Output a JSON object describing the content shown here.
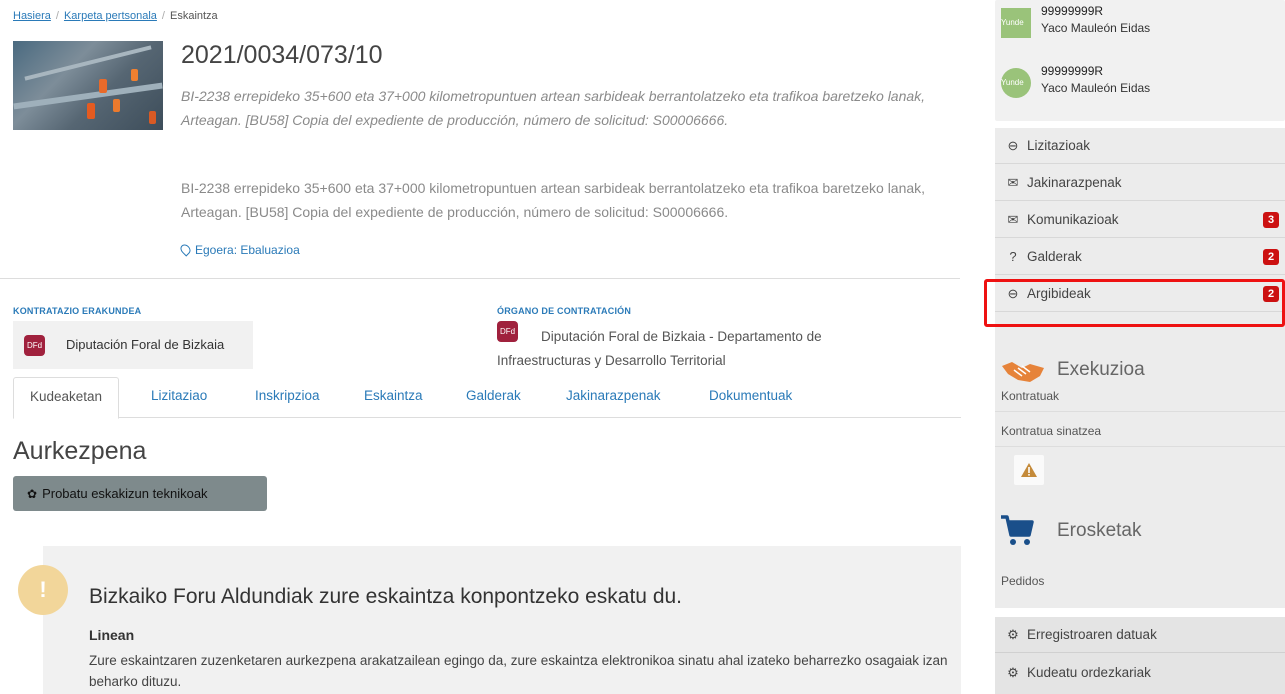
{
  "breadcrumb": {
    "home": "Hasiera",
    "folder": "Karpeta pertsonala",
    "current": "Eskaintza"
  },
  "header": {
    "expedient": "2021/0034/073/10",
    "description_italic": "BI-2238 errepideko 35+600 eta 37+000 kilometropuntuen artean sarbideak berrantolatzeko eta trafikoa baretzeko lanak, Arteagan. [BU58] Copia del expediente de producción, número de solicitud: S00006666.",
    "description": "BI-2238 errepideko 35+600 eta 37+000 kilometropuntuen artean sarbideak berrantolatzeko eta trafikoa baretzeko lanak, Arteagan. [BU58] Copia del expediente de producción, número de solicitud: S00006666.",
    "status": "Egoera: Ebaluazioa"
  },
  "org": {
    "contracting_label": "KONTRATAZIO ERAKUNDEA",
    "contracting_logo": "DFd",
    "contracting_name": "Diputación Foral de Bizkaia",
    "organ_label": "ÓRGANO DE CONTRATACIÓN",
    "organ_logo": "DFd",
    "organ_name": "Diputación Foral de Bizkaia - Departamento de Infraestructuras y Desarrollo Territorial"
  },
  "tabs": [
    {
      "label": "Kudeaketan"
    },
    {
      "label": "Lizitaziao"
    },
    {
      "label": "Inskripzioa"
    },
    {
      "label": "Eskaintza"
    },
    {
      "label": "Galderak"
    },
    {
      "label": "Jakinarazpenak"
    },
    {
      "label": "Dokumentuak"
    }
  ],
  "main": {
    "section_title": "Aurkezpena",
    "tech_button": "Probatu eskakizun teknikoak",
    "alert_icon": "!",
    "alert_title": "Bizkaiko Foru Aldundiak zure eskaintza konpontzeko eskatu du.",
    "alert_subtitle": "Linean",
    "alert_body": "Zure eskaintzaren zuzenketaren aurkezpena arakatzailean egingo da, zure eskaintza elektronikoa sinatu ahal izateko beharrezko osagaiak izan beharko dituzu."
  },
  "users": [
    {
      "id": "99999999R",
      "name": "Yaco Mauleón Eidas",
      "avatar": "Yunde"
    },
    {
      "id": "99999999R",
      "name": "Yaco Mauleón Eidas",
      "avatar": "Yunde"
    }
  ],
  "menu": [
    {
      "label": "Lizitazioak",
      "icon": "inbox-icon",
      "badge": ""
    },
    {
      "label": "Jakinarazpenak",
      "icon": "envelope-icon",
      "badge": ""
    },
    {
      "label": "Komunikazioak",
      "icon": "envelope-icon",
      "badge": "3"
    },
    {
      "label": "Galderak",
      "icon": "question-icon",
      "badge": "2"
    },
    {
      "label": "Argibideak",
      "icon": "inbox-icon",
      "badge": "2"
    }
  ],
  "execution": {
    "title": "Exekuzioa",
    "items": [
      "Kontratuak",
      "Kontratua sinatzea"
    ]
  },
  "purchases": {
    "title": "Erosketak",
    "items": [
      "Pedidos"
    ]
  },
  "registry": [
    {
      "label": "Erregistroaren datuak"
    },
    {
      "label": "Kudeatu ordezkariak"
    }
  ],
  "colors": {
    "link": "#2a7ab8",
    "badge": "#cc1111",
    "highlight": "#ee1111",
    "logo": "#a0213d",
    "cart": "#1a4f8a",
    "hands": "#e6833a"
  }
}
